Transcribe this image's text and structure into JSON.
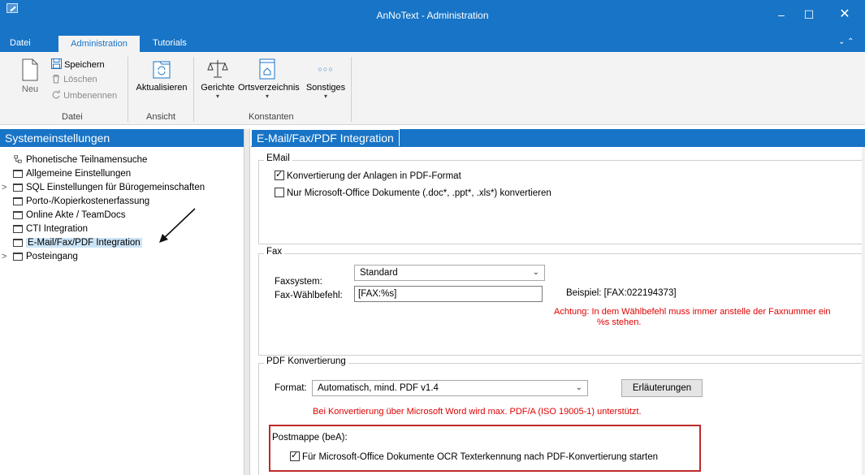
{
  "window": {
    "title": "AnNoText - Administration",
    "minimize": "–",
    "maximize": "☐",
    "close": "✕",
    "collapse": "⌄ ⌃"
  },
  "tabs": {
    "file": "Datei",
    "admin": "Administration",
    "tutorials": "Tutorials"
  },
  "ribbon": {
    "new_label": "Neu",
    "save_label": "Speichern",
    "delete_label": "Löschen",
    "rename_label": "Umbenennen",
    "refresh_label": "Aktualisieren",
    "courts_label": "Gerichte",
    "places_label": "Ortsverzeichnis",
    "other_label": "Sonstiges",
    "other_icon_text": "○○○",
    "group_file": "Datei",
    "group_view": "Ansicht",
    "group_constants": "Konstanten",
    "caret": "▾"
  },
  "left": {
    "header": "Systemeinstellungen",
    "items": [
      {
        "label": "Phonetische Teilnamensuche",
        "expander": ""
      },
      {
        "label": "Allgemeine Einstellungen",
        "expander": ""
      },
      {
        "label": "SQL Einstellungen für Bürogemeinschaften",
        "expander": ">"
      },
      {
        "label": "Porto-/Kopierkostenerfassung",
        "expander": ""
      },
      {
        "label": "Online Akte / TeamDocs",
        "expander": ""
      },
      {
        "label": "CTI Integration",
        "expander": ""
      },
      {
        "label": "E-Mail/Fax/PDF Integration",
        "expander": ""
      },
      {
        "label": "Posteingang",
        "expander": ">"
      }
    ]
  },
  "right": {
    "tab": "E-Mail/Fax/PDF Integration",
    "email": {
      "title": "EMail",
      "cb1": "Konvertierung der Anlagen in PDF-Format",
      "cb2": "Nur Microsoft-Office Dokumente (.doc*, .ppt*, .xls*) konvertieren"
    },
    "fax": {
      "title": "Fax",
      "system_label": "Faxsystem:",
      "system_value": "Standard",
      "dial_label": "Fax-Wählbefehl:",
      "dial_value": "[FAX:%s]",
      "example": "Beispiel: [FAX:022194373]",
      "warning1": "Achtung:  In dem Wählbefehl muss immer anstelle der Faxnummer ein",
      "warning2": "%s stehen."
    },
    "pdf": {
      "title": "PDF Konvertierung",
      "format_label": "Format:",
      "format_value": "Automatisch, mind. PDF v1.4",
      "explain_button": "Erläuterungen",
      "warning": "Bei Konvertierung über Microsoft Word wird max. PDF/A (ISO 19005-1) unterstützt.",
      "postmappe_title": "Postmappe (beA):",
      "postmappe_cb": "Für Microsoft-Office Dokumente OCR Texterkennung nach PDF-Konvertierung starten"
    },
    "combo_arrow": "⌄"
  },
  "colors": {
    "accent": "#1874c6",
    "warning": "#e00000",
    "highlight": "#c0292b",
    "selection": "#cce4f7"
  }
}
